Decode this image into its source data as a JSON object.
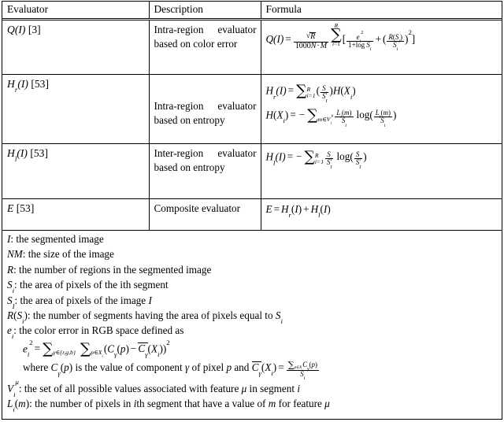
{
  "table": {
    "headers": [
      "Evaluator",
      "Description",
      "Formula"
    ],
    "rows": [
      {
        "evaluator": "Q(I) [3]",
        "evaluator_symbol": "Q(I)",
        "reference": "[3]",
        "description": "Intra-region evaluator based on color error",
        "formula_text": "Q(I) = (sqrt(R) / (1000 N·M)) * sum_{i=1}^{R} [ e_i^2 / (1 + log S_i) + ( R(S_i) / S_i )^2 ]",
        "formula_parts": {
          "lhs": "Q(I)",
          "coef_num": "R",
          "coef_den": "1000N·M",
          "sum_upper": "R",
          "sum_lower": "i=1",
          "term1_num": "e_i^2",
          "term1_den": "1+log S_i",
          "term2_num": "R(S_i)",
          "term2_den": "S_i",
          "term2_exp": "2"
        }
      },
      {
        "evaluator": "H_r(I) [53]",
        "evaluator_symbol": "Hr(I)",
        "reference": "[53]",
        "description": "Intra-region evaluator based on entropy",
        "formula_text": "H_r(I) = sum_{i=1}^{R} (S_i / S_I) H(X_i);  H(X_i) = - sum_{m in V_i^mu} (L_i(m)/S_i) log(L_i(m)/S_i)",
        "formula_parts": {
          "line1_lhs": "H_r(I)",
          "line1_sum_upper": "R",
          "line1_sum_lower": "i=1",
          "line1_frac_num": "S_i",
          "line1_frac_den": "S_I",
          "line1_tail": "H(X_i)",
          "line2_lhs": "H(X_i)",
          "line2_sum_lower": "m∈V_i^μ",
          "line2_frac_num": "L_i(m)",
          "line2_frac_den": "S_i",
          "line2_log_num": "L_i(m)",
          "line2_log_den": "S_i"
        }
      },
      {
        "evaluator": "H_l(I) [53]",
        "evaluator_symbol": "Hl(I)",
        "reference": "[53]",
        "description": "Inter-region evaluator based on entropy",
        "formula_text": "H_l(I) = - sum_{i=1}^{R} (S_i / S_I) log(S_i / S_I)",
        "formula_parts": {
          "lhs": "H_l(I)",
          "sum_upper": "R",
          "sum_lower": "i=1",
          "frac_num": "S_i",
          "frac_den": "S_I",
          "log_num": "S_i",
          "log_den": "S_I"
        }
      },
      {
        "evaluator": "E [53]",
        "evaluator_symbol": "E",
        "reference": "[53]",
        "description": "Composite evaluator",
        "formula_text": "E = H_r(I) + H_l(I)",
        "formula_parts": {
          "lhs": "E",
          "rhs1": "H_r(I)",
          "rhs2": "H_l(I)"
        }
      }
    ]
  },
  "legend": {
    "lines": [
      {
        "symbol": "I",
        "text": ": the segmented image"
      },
      {
        "symbol": "NM",
        "text": ": the size of the image"
      },
      {
        "symbol": "R",
        "text": ": the number of regions in the segmented image"
      },
      {
        "symbol": "S_i",
        "text": ": the area of pixels of the ith segment"
      },
      {
        "symbol": "S_I",
        "text": ": the area of pixels of the image I"
      },
      {
        "symbol": "R(S_i)",
        "text": ": the number of segments having the area of pixels equal to S_i"
      },
      {
        "symbol": "e_i",
        "text": ": the color error in RGB space defined as"
      },
      {
        "symbol": "e_i^2",
        "text": "= sum_{gamma in {r,g,b}} sum_{p in X_i} ( C_gamma(p) - mean C_gamma(X_i) )^2"
      },
      {
        "symbol": "where",
        "text": "where C_gamma(p) is the value of component gamma of pixel p and mean C_gamma(X_i) = ( sum_{p in X_i} C_gamma(p) ) / S_i"
      },
      {
        "symbol": "V_i^mu",
        "text": ": the set of all possible values associated with feature mu in segment i"
      },
      {
        "symbol": "L_i(m)",
        "text": ": the number of pixels in ith segment that have a value of m for feature mu"
      }
    ],
    "words": {
      "the": "the",
      "segmented_image": "segmented image",
      "size_of_image": "size of the image",
      "number_of_regions": "number of regions in the segmented image",
      "area_ith_segment": "area of pixels of the ith segment",
      "area_image": "area of pixels of the image",
      "num_segments_having": "number of segments having the area of pixels equal to",
      "color_error": "color error in RGB space defined as",
      "where": "where",
      "is_value_of_component": "is the value of component",
      "of_pixel": "of pixel",
      "and": "and",
      "set_of_all_values": "set of all possible values associated with feature",
      "in_segment": "in segment",
      "num_pixels_in": "number of pixels in",
      "th_segment_have": "th segment that have a value of",
      "for_feature": "for feature"
    }
  },
  "colors": {
    "border": "#000000",
    "background": "#ffffff",
    "text": "#000000"
  }
}
